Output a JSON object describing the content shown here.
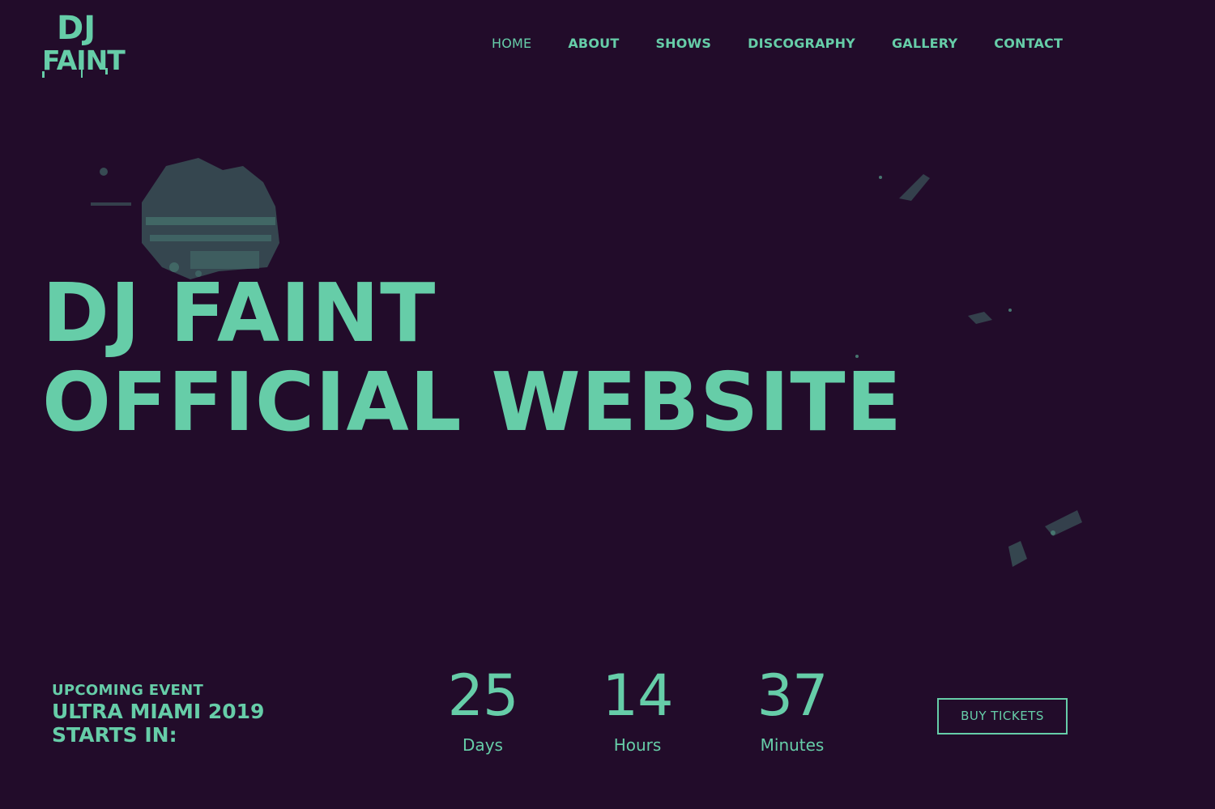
{
  "brand": {
    "logo_line1": "DJ",
    "logo_line2": "FAINT"
  },
  "nav": {
    "items": [
      {
        "label": "HOME",
        "active": true
      },
      {
        "label": "ABOUT"
      },
      {
        "label": "SHOWS"
      },
      {
        "label": "DISCOGRAPHY"
      },
      {
        "label": "GALLERY"
      },
      {
        "label": "CONTACT"
      }
    ]
  },
  "hero": {
    "title_line1": "DJ FAINT",
    "title_line2": "OFFICIAL WEBSITE"
  },
  "event": {
    "kicker": "UPCOMING EVENT",
    "name": "ULTRA MIAMI 2019",
    "starts": "STARTS IN:"
  },
  "countdown": {
    "days": {
      "value": "25",
      "label": "Days"
    },
    "hours": {
      "value": "14",
      "label": "Hours"
    },
    "minutes": {
      "value": "37",
      "label": "Minutes"
    }
  },
  "cta": {
    "buy_label": "BUY TICKETS"
  },
  "colors": {
    "background": "#220c2a",
    "accent": "#66cda8"
  }
}
